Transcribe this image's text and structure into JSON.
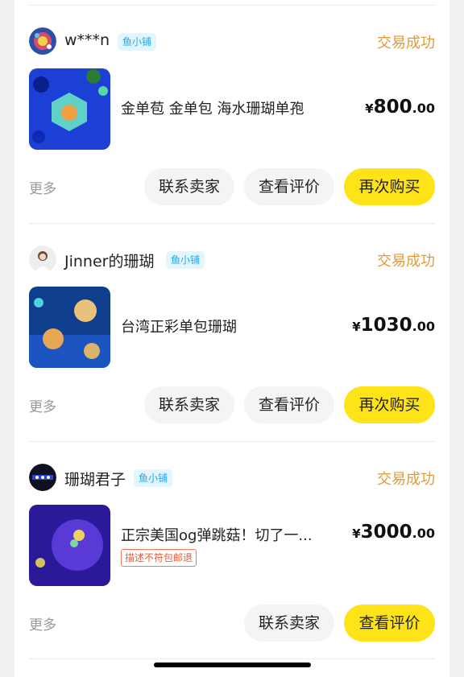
{
  "orders": [
    {
      "seller": "w***n",
      "tag": "鱼小铺",
      "status": "交易成功",
      "title": "金单苞 金单包 海水珊瑚单孢",
      "price_currency": "¥",
      "price_int": "800",
      "price_dec": ".00",
      "more": "更多",
      "buttons": [
        "联系卖家",
        "查看评价",
        "再次购买"
      ]
    },
    {
      "seller": "Jinner的珊瑚",
      "tag": "鱼小铺",
      "status": "交易成功",
      "title": "台湾正彩单包珊瑚",
      "price_currency": "¥",
      "price_int": "1030",
      "price_dec": ".00",
      "more": "更多",
      "buttons": [
        "联系卖家",
        "查看评价",
        "再次购买"
      ]
    },
    {
      "seller": "珊瑚君子",
      "tag": "鱼小铺",
      "status": "交易成功",
      "title": "正宗美国og弹跳菇！切了一...",
      "promise": "描述不符包邮退",
      "price_currency": "¥",
      "price_int": "3000",
      "price_dec": ".00",
      "more": "更多",
      "buttons": [
        "联系卖家",
        "查看评价"
      ]
    }
  ],
  "colors": {
    "status": "#e09a3c",
    "tag_bg": "#e3f6ff",
    "tag_text": "#22a7e6",
    "primary_button": "#ffe319",
    "secondary_button": "#f4f4f4"
  }
}
